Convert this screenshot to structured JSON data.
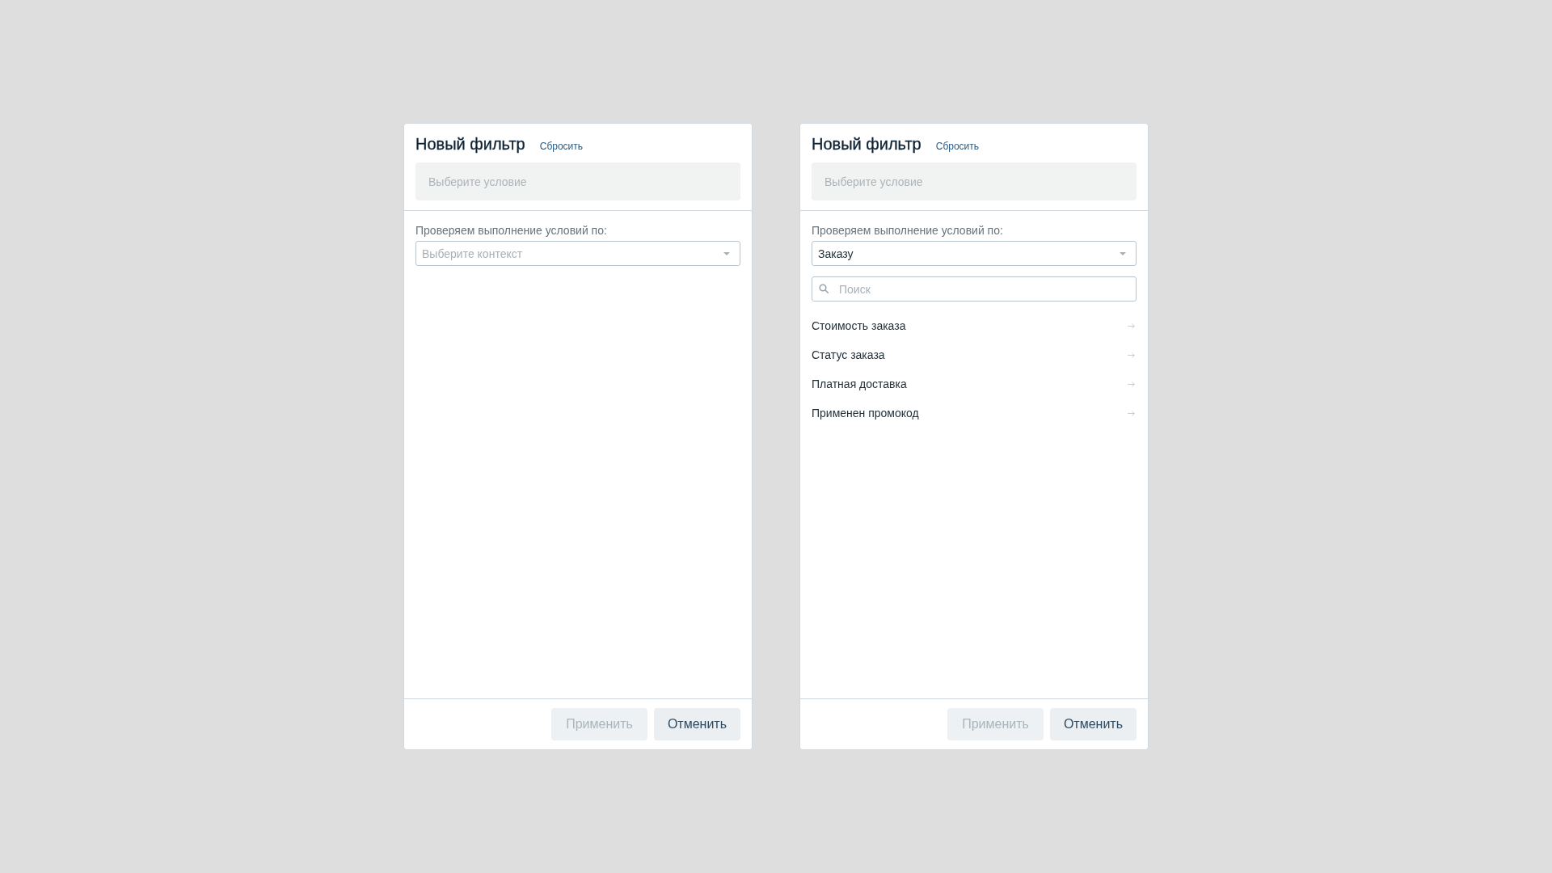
{
  "panels": [
    {
      "title": "Новый фильтр",
      "reset_link": "Сбросить",
      "condition_field": {
        "placeholder": "Выберите условие"
      },
      "context_label": "Проверяем выполнение условий по:",
      "context_select": {
        "placeholder": "Выберите контекст"
      },
      "buttons": [
        {
          "label": "Применить",
          "disabled": true
        },
        {
          "label": "Отменить",
          "disabled": false
        }
      ]
    },
    {
      "title": "Новый фильтр",
      "reset_link": "Сбросить",
      "condition_field": {
        "placeholder": "Выберите условие"
      },
      "context_label": "Проверяем выполнение условий по:",
      "context_select": {
        "value": "Заказу"
      },
      "search": {
        "placeholder": "Поиск"
      },
      "items": [
        {
          "label": "Стоимость заказа"
        },
        {
          "label": "Статус заказа"
        },
        {
          "label": "Платная доставка"
        },
        {
          "label": "Применен промокод"
        }
      ],
      "buttons": [
        {
          "label": "Применить",
          "disabled": true
        },
        {
          "label": "Отменить",
          "disabled": false
        }
      ]
    }
  ]
}
